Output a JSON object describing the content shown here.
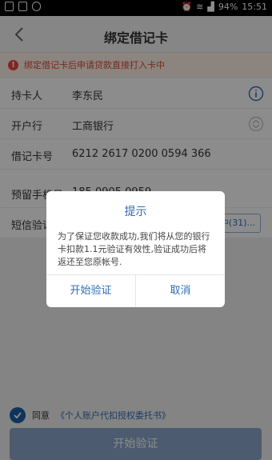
{
  "status_bar": {
    "battery_percent": "94%",
    "time": "15:51"
  },
  "nav": {
    "title": "绑定借记卡"
  },
  "notice": {
    "text": "绑定借记卡后申请贷款直接打入卡中"
  },
  "form": {
    "holder_label": "持卡人",
    "holder_value": "李东民",
    "bank_label": "开户行",
    "bank_value": "工商银行",
    "card_label": "借记卡号",
    "card_value": "6212 2617 0200 0594 366",
    "phone_label": "预留手机号",
    "phone_value": "185 0905 0959",
    "sms_label": "短信验证",
    "sms_button": "中(31)..."
  },
  "agreement": {
    "prefix": "同意",
    "link": "《个人账户代扣授权委托书》"
  },
  "primary_button": {
    "label": "开始验证"
  },
  "dialog": {
    "title": "提示",
    "message": "为了保证您收款成功,我们将从您的银行卡扣款1.1元验证有效性,验证成功后将返还至您原帐号.",
    "confirm": "开始验证",
    "cancel": "取消"
  },
  "colors": {
    "accent": "#2f6db3",
    "notice": "#d9493a",
    "primary_button": "#8aa6cb"
  }
}
